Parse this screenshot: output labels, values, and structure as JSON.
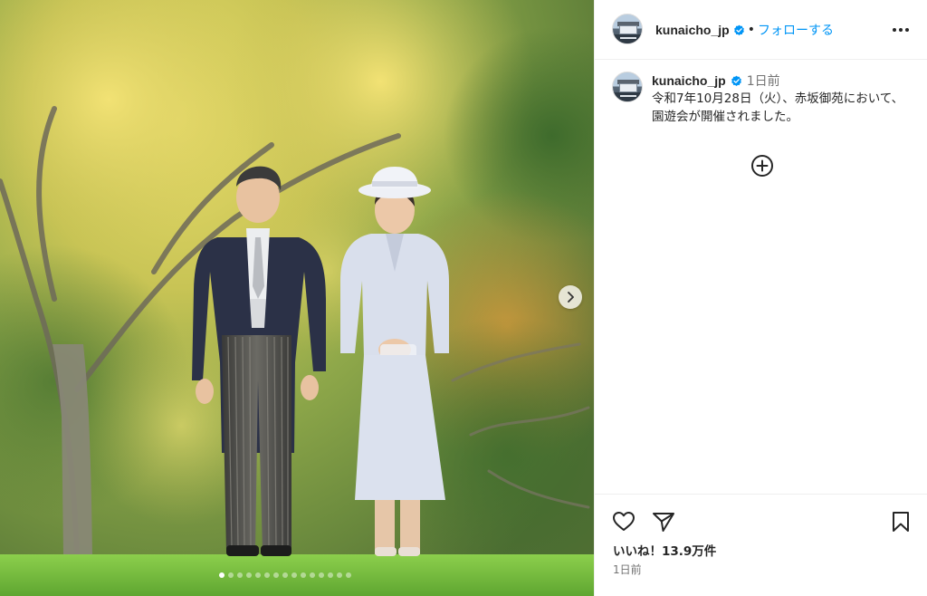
{
  "post": {
    "username": "kunaicho_jp",
    "follow_label": "フォローする",
    "separator": "•",
    "caption_time": "1日前",
    "caption_text": "令和7年10月28日（火）、赤坂御苑において、園遊会が開催されました。",
    "likes_label": "いいね！13.9万件",
    "posted_time": "1日前"
  },
  "carousel": {
    "slide_count": 15,
    "active_index": 0
  },
  "icons": {
    "verified": "verified-badge-icon",
    "more": "more-options-icon",
    "add_comment": "plus-circle-icon",
    "like": "heart-icon",
    "share": "paper-plane-icon",
    "save": "bookmark-icon",
    "carousel_next": "chevron-right-icon"
  },
  "colors": {
    "accent": "#0095f6",
    "text": "#262626",
    "muted": "#737373",
    "border": "#efefef"
  }
}
